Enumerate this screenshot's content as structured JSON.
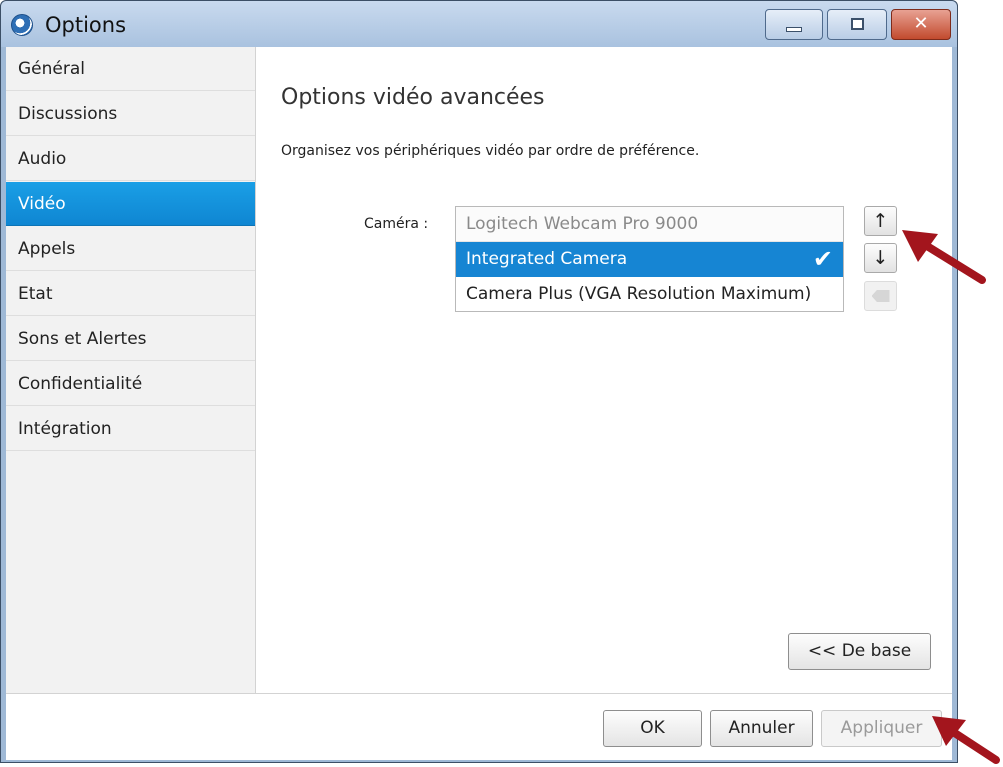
{
  "window": {
    "title": "Options",
    "minimize_label": "Minimize",
    "maximize_label": "Maximize",
    "close_label": "Close",
    "close_glyph": "✕"
  },
  "sidebar": {
    "items": [
      {
        "label": "Général"
      },
      {
        "label": "Discussions"
      },
      {
        "label": "Audio"
      },
      {
        "label": "Vidéo",
        "active": true
      },
      {
        "label": "Appels"
      },
      {
        "label": "Etat"
      },
      {
        "label": "Sons et Alertes"
      },
      {
        "label": "Confidentialité"
      },
      {
        "label": "Intégration"
      }
    ]
  },
  "main": {
    "heading": "Options vidéo avancées",
    "description": "Organisez vos périphériques vidéo  par ordre de préférence.",
    "camera_label": "Caméra :",
    "cameras": [
      {
        "label": "Logitech Webcam Pro 9000",
        "state": "disabled"
      },
      {
        "label": "Integrated Camera",
        "state": "selected"
      },
      {
        "label": "Camera Plus (VGA Resolution Maximum)",
        "state": "normal"
      }
    ],
    "check_glyph": "✔",
    "up_glyph": "↑",
    "down_glyph": "↓",
    "basic_button": "<< De base"
  },
  "footer": {
    "ok": "OK",
    "cancel": "Annuler",
    "apply": "Appliquer"
  },
  "colors": {
    "accent": "#1685d3",
    "annotation_arrow": "#a3151d"
  }
}
